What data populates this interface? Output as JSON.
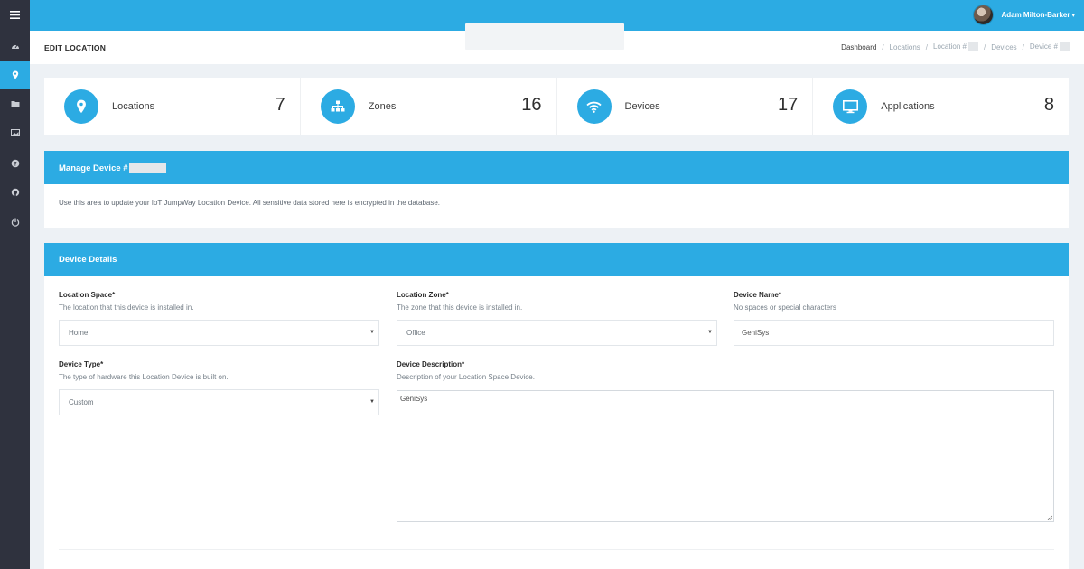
{
  "user": {
    "name": "Adam Milton-Barker"
  },
  "page": {
    "title": "EDIT LOCATION"
  },
  "breadcrumb": [
    "Dashboard",
    "Locations",
    "Location #",
    "Devices",
    "Device #"
  ],
  "stats": [
    {
      "label": "Locations",
      "value": "7",
      "icon": "map-pin-icon"
    },
    {
      "label": "Zones",
      "value": "16",
      "icon": "sitemap-icon"
    },
    {
      "label": "Devices",
      "value": "17",
      "icon": "wifi-icon"
    },
    {
      "label": "Applications",
      "value": "8",
      "icon": "monitor-icon"
    }
  ],
  "manage": {
    "title": "Manage Device #",
    "intro": "Use this area to update your IoT JumpWay Location Device. All sensitive data stored here is encrypted in the database."
  },
  "details": {
    "title": "Device Details",
    "location_space": {
      "label": "Location Space*",
      "help": "The location that this device is installed in.",
      "value": "Home"
    },
    "location_zone": {
      "label": "Location Zone*",
      "help": "The zone that this device is installed in.",
      "value": "Office"
    },
    "device_name": {
      "label": "Device Name*",
      "help": "No spaces or special characters",
      "value": "GeniSys"
    },
    "device_type": {
      "label": "Device Type*",
      "help": "The type of hardware this Location Device is built on.",
      "value": "Custom"
    },
    "device_description": {
      "label": "Device Description*",
      "help": "Description of your Location Space Device.",
      "value": "GeniSys"
    }
  },
  "colors": {
    "accent": "#2cabe3",
    "sidebar": "#2f323e",
    "background": "#edf1f5"
  }
}
